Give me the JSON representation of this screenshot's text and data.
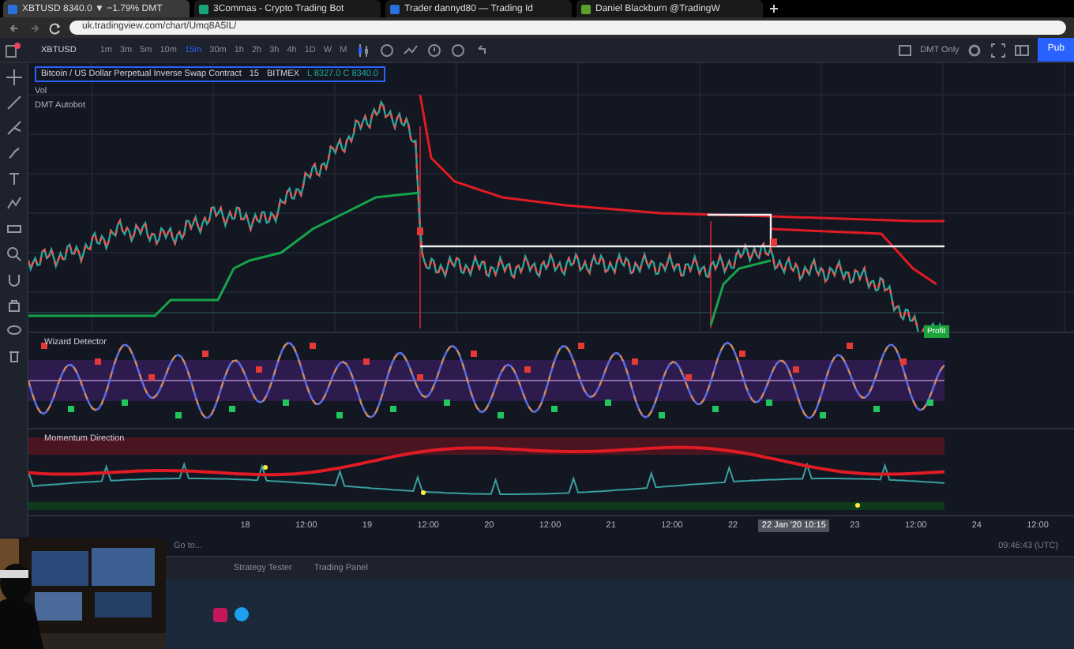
{
  "browser": {
    "tabs": [
      {
        "label": "XBTUSD 8340.0 ▼ −1.79% DMT",
        "selected": true
      },
      {
        "label": "3Commas - Crypto Trading Bot",
        "selected": false
      },
      {
        "label": "Trader dannyd80 — Trading Id",
        "selected": false
      },
      {
        "label": "Daniel Blackburn @TradingW",
        "selected": false
      }
    ],
    "address": "uk.tradingview.com/chart/Umq8A5IL/"
  },
  "toolbar": {
    "symbol": "XBTUSD",
    "intervals": [
      {
        "label": "1m",
        "selected": false
      },
      {
        "label": "3m",
        "selected": false
      },
      {
        "label": "5m",
        "selected": false
      },
      {
        "label": "10m",
        "selected": false
      },
      {
        "label": "15m",
        "selected": true
      },
      {
        "label": "30m",
        "selected": false
      },
      {
        "label": "1h",
        "selected": false
      },
      {
        "label": "2h",
        "selected": false
      },
      {
        "label": "3h",
        "selected": false
      },
      {
        "label": "4h",
        "selected": false
      },
      {
        "label": "1D",
        "selected": false
      },
      {
        "label": "W",
        "selected": false
      },
      {
        "label": "M",
        "selected": false
      }
    ],
    "layout_label": "DMT Only",
    "publish": "Pub"
  },
  "chart": {
    "title": "Bitcoin / US Dollar Perpetual Inverse Swap Contract",
    "interval": "15",
    "exchange": "BITMEX",
    "ohlc": "L 8327.0  C 8340.0",
    "legend": [
      "Vol",
      "DMT Autobot"
    ],
    "badge": "Profit"
  },
  "panes": [
    {
      "title": "Wizard Detector"
    },
    {
      "title": "Momentum Direction"
    }
  ],
  "time_axis": [
    {
      "kind": "tick",
      "label": "18"
    },
    {
      "kind": "tick",
      "label": "12:00"
    },
    {
      "kind": "tick",
      "label": "19"
    },
    {
      "kind": "tick",
      "label": "12:00"
    },
    {
      "kind": "tick",
      "label": "20"
    },
    {
      "kind": "tick",
      "label": "12:00"
    },
    {
      "kind": "tick",
      "label": "21"
    },
    {
      "kind": "tick",
      "label": "12:00"
    },
    {
      "kind": "tick",
      "label": "22"
    },
    {
      "kind": "cursor",
      "label": "22 Jan '20  10:15"
    },
    {
      "kind": "tick",
      "label": "23"
    },
    {
      "kind": "tick",
      "label": "12:00"
    },
    {
      "kind": "tick",
      "label": "24"
    },
    {
      "kind": "tick",
      "label": "12:00"
    }
  ],
  "footer": {
    "goto": "Go to...",
    "clock": "09:46:43 (UTC)",
    "tabs": [
      "Strategy Tester",
      "Trading Panel"
    ]
  }
}
